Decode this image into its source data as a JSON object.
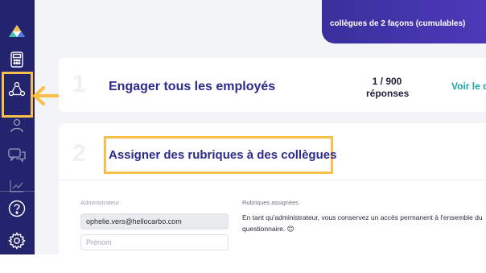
{
  "banner": {
    "text": "collègues de 2 façons (cumulables)"
  },
  "sidebar": {
    "items": [
      {
        "name": "logo"
      },
      {
        "name": "calculator"
      },
      {
        "name": "employees",
        "active": true
      },
      {
        "name": "user"
      },
      {
        "name": "chat"
      },
      {
        "name": "chart"
      },
      {
        "name": "help"
      },
      {
        "name": "settings"
      }
    ]
  },
  "step1": {
    "number": "1",
    "title": "Engager tous les employés",
    "count": "1 / 900",
    "count_label": "réponses",
    "link": "Voir le d"
  },
  "step2": {
    "number": "2",
    "title": "Assigner des rubriques à des collègues",
    "admin_label": "Administrateur",
    "email": "ophelie.vers@hellocarbo.com",
    "firstname_placeholder": "Prénom",
    "rubriques_label": "Rubriques assignées",
    "rubriques_text": "En tant qu'administrateur, vous conservez un accès permanent à l'ensemble du questionnaire. 😊"
  },
  "colors": {
    "sidebar": "#24236e",
    "title": "#2c2a8c",
    "highlight": "#f6c04a",
    "link": "#1aa7a3"
  }
}
